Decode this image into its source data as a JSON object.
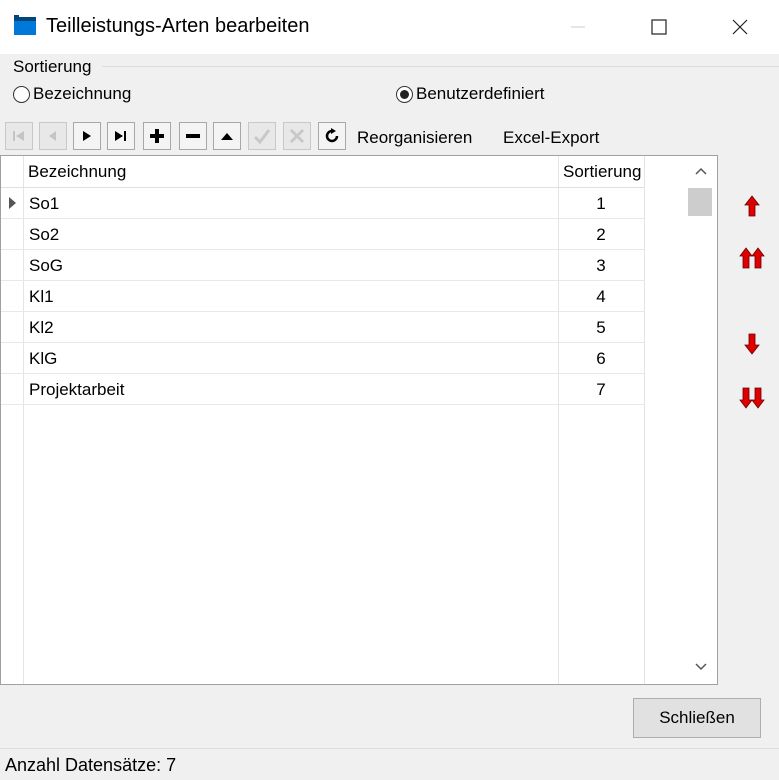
{
  "window": {
    "title": "Teilleistungs-Arten bearbeiten",
    "icon": "blue-window-icon",
    "controls": [
      "minimize-icon",
      "maximize-icon",
      "close-icon"
    ]
  },
  "sort_group": {
    "label": "Sortierung",
    "options": [
      {
        "label": "Bezeichnung",
        "selected": false
      },
      {
        "label": "Benutzerdefiniert",
        "selected": true
      }
    ]
  },
  "toolbar": {
    "buttons": [
      {
        "icon": "first-record-icon",
        "enabled": false
      },
      {
        "icon": "prior-record-icon",
        "enabled": false
      },
      {
        "icon": "next-record-icon",
        "enabled": true
      },
      {
        "icon": "last-record-icon",
        "enabled": true
      },
      {
        "icon": "insert-icon",
        "enabled": true
      },
      {
        "icon": "delete-icon",
        "enabled": true
      },
      {
        "icon": "edit-icon",
        "enabled": true
      },
      {
        "icon": "post-icon",
        "enabled": false
      },
      {
        "icon": "cancel-icon",
        "enabled": false
      },
      {
        "icon": "refresh-icon",
        "enabled": true
      }
    ],
    "reorganize_label": "Reorganisieren",
    "export_label": "Excel-Export"
  },
  "grid": {
    "columns": [
      "Bezeichnung",
      "Sortierung"
    ],
    "rows": [
      {
        "name": "So1",
        "sort": "1",
        "current": true
      },
      {
        "name": "So2",
        "sort": "2"
      },
      {
        "name": "SoG",
        "sort": "3"
      },
      {
        "name": "Kl1",
        "sort": "4"
      },
      {
        "name": "Kl2",
        "sort": "5"
      },
      {
        "name": "KlG",
        "sort": "6"
      },
      {
        "name": "Projektarbeit",
        "sort": "7"
      }
    ]
  },
  "move_buttons": [
    "move-up-icon",
    "move-to-top-icon",
    "move-down-icon",
    "move-to-bottom-icon"
  ],
  "colors": {
    "accent_arrow": "#e00000",
    "title_icon": "#0078d7"
  },
  "close_button": "Schließen",
  "status": "Anzahl Datensätze: 7"
}
